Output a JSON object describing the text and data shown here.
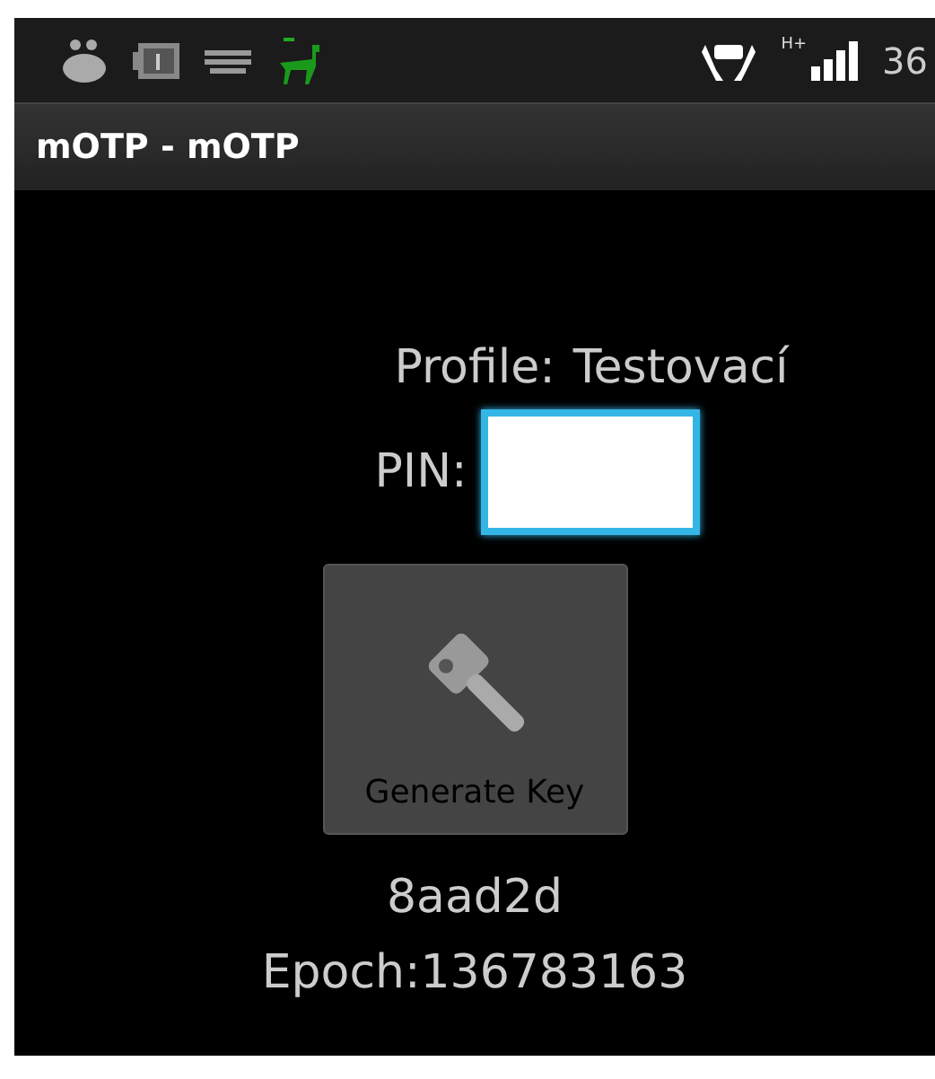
{
  "status_bar": {
    "network": "H+",
    "battery": "36"
  },
  "window": {
    "title": "mOTP - mOTP"
  },
  "profile": {
    "label": "Profile:",
    "value": "Testovací"
  },
  "pin": {
    "label": "PIN:",
    "focused": true
  },
  "generate_button": {
    "label": "Generate Key",
    "disabled": true
  },
  "otp": "8aad2d",
  "epoch": "Epoch:136783163"
}
